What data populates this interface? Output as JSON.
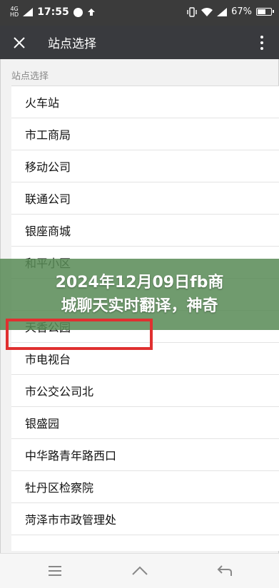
{
  "status_bar": {
    "network": "4G",
    "network_sub": "HD",
    "time": "17:55",
    "battery": "67%",
    "battery_level": 0.67
  },
  "header": {
    "close_icon": "close-icon",
    "title": "站点选择",
    "more_icon": "more-vertical-icon"
  },
  "list": {
    "section_title": "站点选择",
    "items": [
      "火车站",
      "市工商局",
      "移动公司",
      "联通公司",
      "银座商城",
      "和平小区",
      "",
      "天香公园",
      "市电视台",
      "市公交公司北",
      "银盛园",
      "中华路青年路西口",
      "牡丹区检察院",
      "菏泽市市政管理处"
    ]
  },
  "overlay": {
    "line1": "2024年12月09日fb商",
    "line2": "城聊天实时翻译，神奇",
    "color": "#588a56",
    "highlight_color": "#e03030"
  },
  "nav_bar": {
    "menu_icon": "menu-icon",
    "home_icon": "home-icon",
    "back_icon": "back-icon"
  }
}
